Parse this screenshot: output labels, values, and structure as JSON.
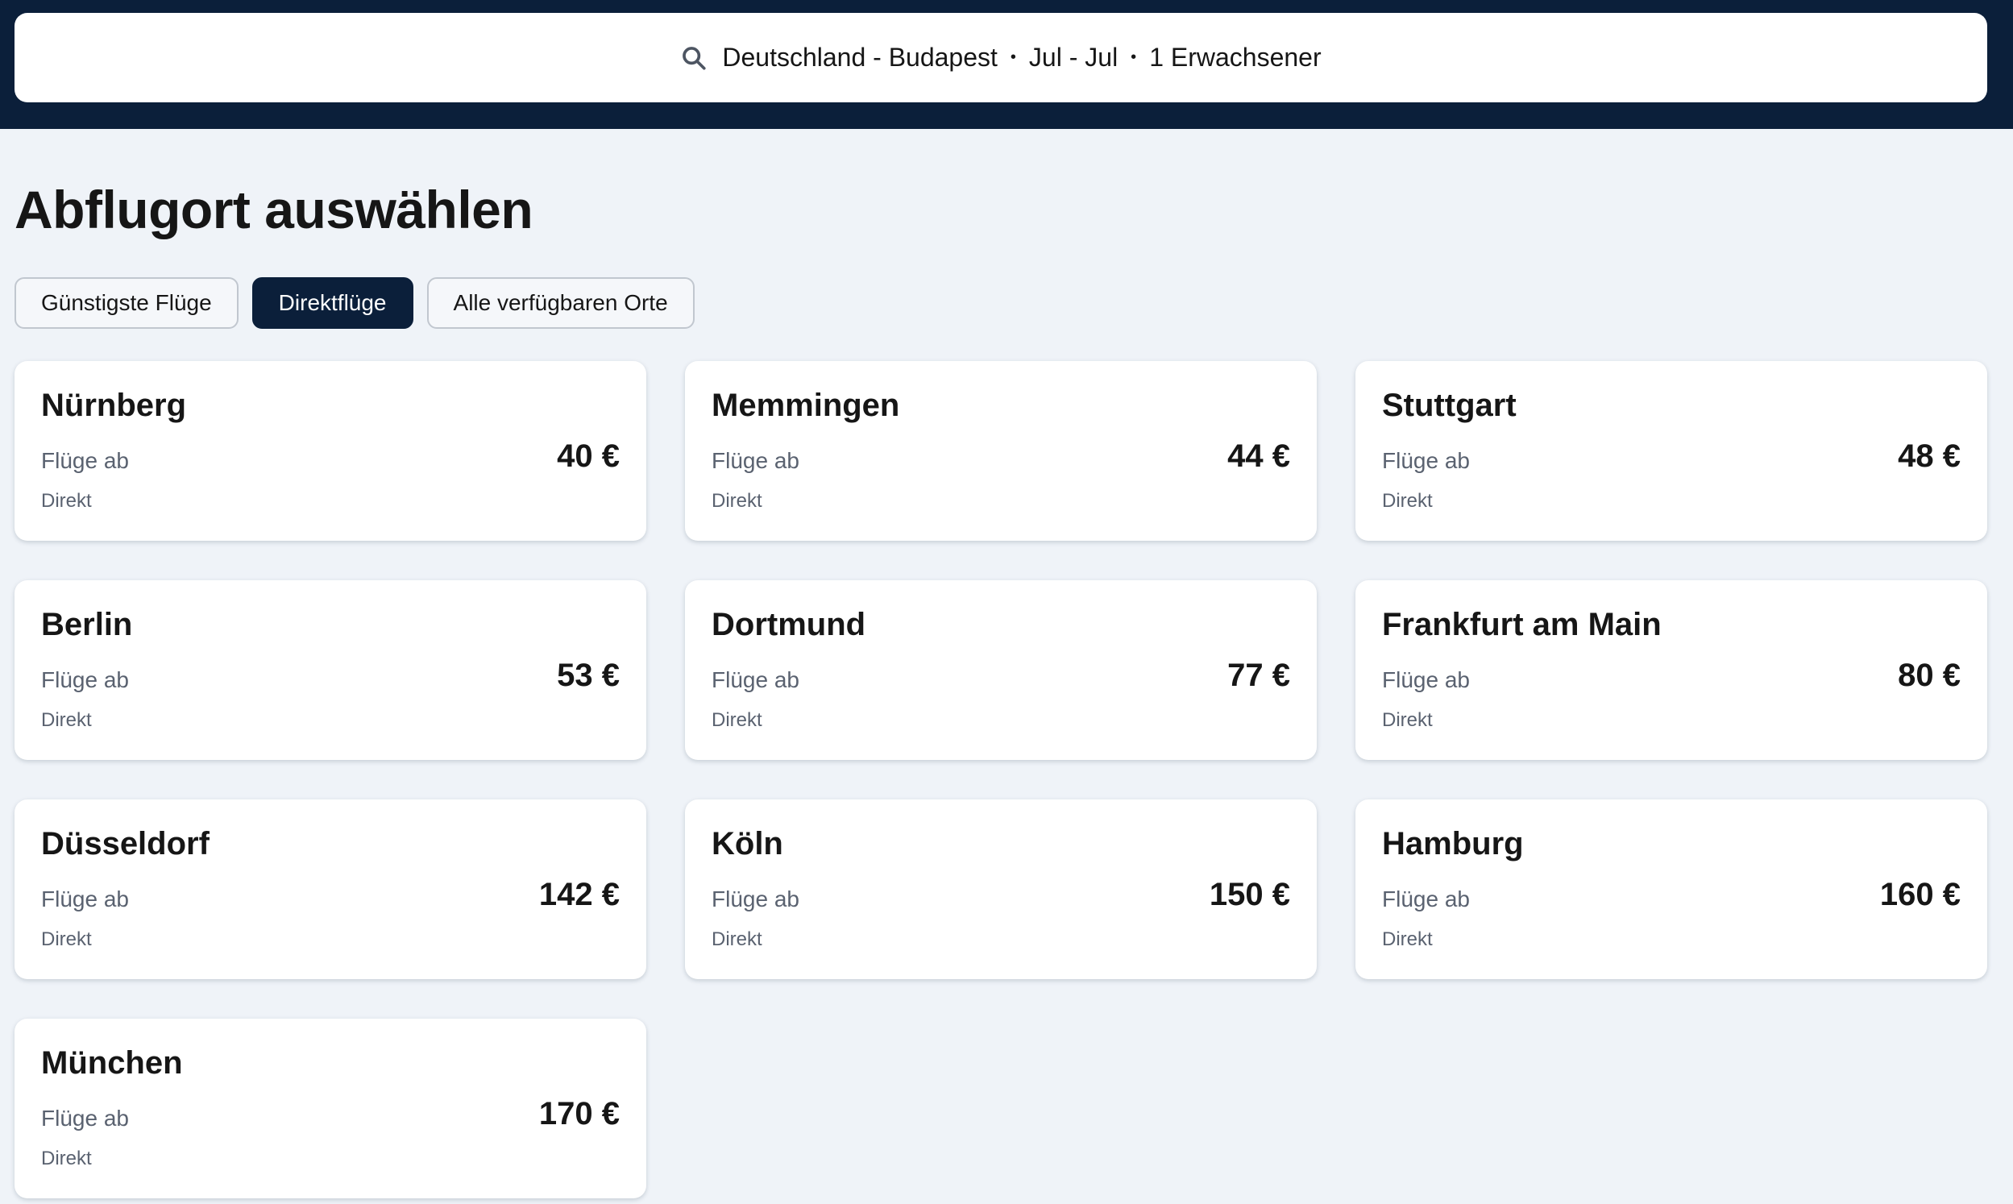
{
  "search": {
    "route": "Deutschland - Budapest",
    "dates": "Jul - Jul",
    "travellers": "1 Erwachsener",
    "separator": "•"
  },
  "page": {
    "title": "Abflugort auswählen"
  },
  "filters": [
    {
      "label": "Günstigste Flüge",
      "active": false
    },
    {
      "label": "Direktflüge",
      "active": true
    },
    {
      "label": "Alle verfügbaren Orte",
      "active": false
    }
  ],
  "card_label": "Flüge ab",
  "results": [
    {
      "city": "Nürnberg",
      "price": "40 €",
      "type": "Direkt"
    },
    {
      "city": "Memmingen",
      "price": "44 €",
      "type": "Direkt"
    },
    {
      "city": "Stuttgart",
      "price": "48 €",
      "type": "Direkt"
    },
    {
      "city": "Berlin",
      "price": "53 €",
      "type": "Direkt"
    },
    {
      "city": "Dortmund",
      "price": "77 €",
      "type": "Direkt"
    },
    {
      "city": "Frankfurt am Main",
      "price": "80 €",
      "type": "Direkt"
    },
    {
      "city": "Düsseldorf",
      "price": "142 €",
      "type": "Direkt"
    },
    {
      "city": "Köln",
      "price": "150 €",
      "type": "Direkt"
    },
    {
      "city": "Hamburg",
      "price": "160 €",
      "type": "Direkt"
    },
    {
      "city": "München",
      "price": "170 €",
      "type": "Direkt"
    }
  ],
  "colors": {
    "header_bg": "#0b1f3a",
    "page_bg": "#eff3f8",
    "active_chip": "#0b1f3a"
  },
  "icons": {
    "search": "search-icon"
  }
}
